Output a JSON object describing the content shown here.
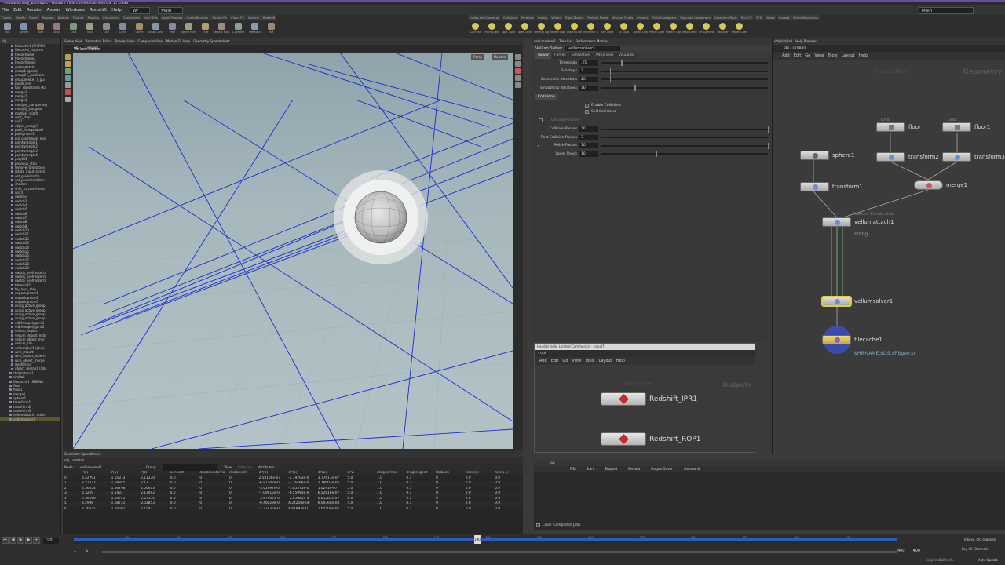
{
  "app": {
    "title": "F:/Houdini/fluffy_ball.hipnc - Houdini Indie Limited-Commercial 17.5.xxx"
  },
  "menu": {
    "items": [
      "File",
      "Edit",
      "Render",
      "Assets",
      "Windows",
      "Redshift",
      "Help"
    ],
    "desk1": "Wr",
    "desk2": "Main",
    "desk_right": "Main"
  },
  "shelf": {
    "tabs_left": [
      "Create",
      "Modify",
      "Model",
      "Polygon",
      "Deform",
      "Texture",
      "Rigging",
      "Characters",
      "Constraints",
      "Hair Utils",
      "Guide Process",
      "Guide Brushes",
      "Terrain FX",
      "Cloud FX",
      "Volume",
      "Redshift"
    ],
    "tools_left": [
      "Box",
      "Sphere",
      "Tube",
      "Torus",
      "Grid",
      "Null",
      "Line",
      "Circle",
      "Curve",
      "Draw Curve",
      "Path",
      "Spray Paint",
      "Font",
      "Platonic Solids",
      "L-System",
      "Metaball",
      "File"
    ],
    "tabs_right": [
      "Lights and Cameras",
      "Collisions",
      "Particles",
      "Grains",
      "Vellum",
      "Rigid Bodies",
      "Particle Fluids",
      "Viscous Fluids",
      "Oceans",
      "Fluid Containers",
      "Populate Containers",
      "Container Tools",
      "Pyro FX",
      "FEM",
      "Wires",
      "Crowds",
      "Drive Simulation"
    ],
    "tools_right": [
      "Camera",
      "Point Light",
      "Spot Light",
      "Area Light",
      "Geometry Light",
      "Volume Light",
      "Distant Light",
      "Environment Light",
      "Sky Light",
      "GI Light",
      "Caustic Light",
      "Portal Light",
      "Ambient Light",
      "Stereo Camera",
      "VR Camera",
      "Switcher",
      "Gamepad Camera"
    ]
  },
  "outliner": {
    "tab": "obj",
    "items": [
      "filecache1 (SHIPNA",
      "filecache_no_error",
      "freezeframe",
      "freezeframe1",
      "freezeframe2",
      "groomdetch1",
      "group1 (guide)",
      "group2 (_guidesim",
      "groupdelete1 (_gui",
      "guide_sim",
      "hair_constraints (ha",
      "merge1",
      "merge2",
      "merge3",
      "multiply_dampening",
      "multiply_kangular",
      "multiply_width",
      "next_step",
      "null1",
      "object_merge3",
      "pack_interpolated",
      "packgroom1",
      "pin_constraints (pin",
      "pointwrangle1",
      "pointwrangle2",
      "pointwrangle3",
      "pointwrangle4",
      "poly001",
      "previous_step",
      "remove_simulation",
      "rotate_input_orient",
      "set_guidsimatio",
      "set_postsimulation",
      "shaders",
      "shift_to_startframe",
      "sort1",
      "switch1",
      "switch2",
      "switch4",
      "switch5",
      "switch6",
      "switch7",
      "switch8",
      "switch9",
      "switch10",
      "switch11",
      "switch12",
      "switch13",
      "switch14",
      "switch15",
      "switch16",
      "switch17",
      "switch18",
      "switch19",
      "switch_usefreezefra",
      "switch_usefreezefra",
      "switch_usefreezefra",
      "timeshift1",
      "try_next_step",
      "unpackgroom1",
      "unpackgroom2",
      "unpackgroom3",
      "using_active_group",
      "using_active_group",
      "using_active_group",
      "using_active_group",
      "vdbfrompolygons1",
      "vdbfrompolygons2",
      "vellum_import",
      "vellum_import_exte",
      "vellum_object_mer",
      "vellum_sim",
      "vellumglue1 (glue)",
      "wire_import",
      "wire_import_extern",
      "wire_object_merge",
      "renderHair",
      "object_merge1 (/obj",
      "rbdgltstone1",
      "simBall",
      "filecache1 (SHIPNA",
      "floor",
      "floor1",
      "merge1",
      "sphere1",
      "transform1",
      "transform2",
      "transform3",
      "vellumattach1 (strin",
      "vellumsolver1"
    ],
    "selected": "vellumsolver1"
  },
  "viewport": {
    "tabs": [
      "Scene View",
      "Animation Editor",
      "Render View",
      "Composite View",
      "Motion FX View",
      "Geometry Spreadsheet"
    ],
    "path": [
      "obj",
      "simBall"
    ],
    "title": "Vellum Solver",
    "persp": "Persp",
    "cam": "No cam"
  },
  "spreadsheet": {
    "tab": "Geometry Spreadsheet",
    "path": [
      "obj",
      "simBall"
    ],
    "node_label": "Node:",
    "node": "vellumsolver1",
    "group_label": "Group:",
    "view": "View",
    "intrinsics": "Intrinsics",
    "attributes": "Attributes:",
    "columns": [
      "",
      "P[x]",
      "P[y]",
      "P[z]",
      "airresist",
      "disableexternal",
      "disableself",
      "dP[0]",
      "dP[1]",
      "dP[2]",
      "dPw",
      "dragnormal",
      "dragtangent",
      "fallback",
      "force[0]",
      "force[1]"
    ],
    "rows": [
      [
        "0",
        "3.42791",
        "1.65373",
        "2.11370",
        "0.0",
        "0",
        "0",
        "2.58106e-07",
        "-2.79293e-0",
        "3.77613e-07",
        "5.0",
        "1.0",
        "0.1",
        "0",
        "0.0",
        "0.0"
      ],
      [
        "1",
        "3.37722",
        "1.59345",
        "2.12",
        "0.0",
        "0",
        "0",
        "-6.81102e-0",
        "-3.16486e-0",
        "2.78603e-07",
        "5.0",
        "1.0",
        "0.1",
        "0",
        "0.0",
        "0.0"
      ],
      [
        "2",
        "3.36654",
        "1.66798",
        "2.06613",
        "0.0",
        "0",
        "0",
        "-3.62897e-0",
        "-5.85371e-0",
        "1.0291e-07",
        "5.0",
        "1.0",
        "0.1",
        "0",
        "0.0",
        "0.0"
      ],
      [
        "3",
        "3.3209",
        "1.5481",
        "2.13492",
        "0.0",
        "0",
        "0",
        "-7.09015e-0",
        "-6.55994e-0",
        "6.52618e-07",
        "5.0",
        "1.0",
        "0.1",
        "0",
        "0.0",
        "0.0"
      ],
      [
        "4",
        "3.30668",
        "1.60742",
        "2.07376",
        "0.0",
        "0",
        "0",
        "-3.67507e-0",
        "-2.03853e-0",
        "5.63284e-07",
        "5.0",
        "1.0",
        "0.1",
        "0",
        "0.0",
        "0.0"
      ],
      [
        "5",
        "3.2998",
        "1.68731",
        "2.02853",
        "0.0",
        "0",
        "0",
        "-6.46029e-0",
        "4.24258e-08",
        "6.09368e-08",
        "5.0",
        "1.0",
        "0.1",
        "0",
        "0.0",
        "0.0"
      ],
      [
        "6",
        "3.26835",
        "1.60501",
        "2.1542",
        "0.0",
        "0",
        "0",
        "-7.77435e-0",
        "4.41993e-07",
        "1.65509e-06",
        "5.0",
        "1.0",
        "0.1",
        "0",
        "0.0",
        "0.0"
      ]
    ]
  },
  "params": {
    "tabs": [
      "vellumsolver1",
      "Take List",
      "Performance Monitor"
    ],
    "node_type": "Vellum Solver",
    "node_name": "vellumsolver1",
    "subtabs": [
      "Solver",
      "Forces",
      "Simulation",
      "Advanced",
      "Visualize"
    ],
    "rows1": [
      {
        "label": "Timescale",
        "value": ".25",
        "knob": 0.12
      },
      {
        "label": "Substeps",
        "value": "2",
        "knob": 0.05
      },
      {
        "label": "Constraint Iterations",
        "value": "20",
        "knob": 0.05
      },
      {
        "label": "Smoothing Iterations",
        "value": "10",
        "knob": 0.2
      }
    ],
    "collisions_label": "Collisions",
    "enable_collisions": "Enable Collisions",
    "self_collisions": "Self Collisions",
    "ground_position": "Ground Position",
    "rows2": [
      {
        "label": "Collision Passes",
        "value": "10",
        "knob": 1.0
      },
      {
        "label": "Post Collision Passes",
        "value": "3",
        "knob": 0.3
      },
      {
        "label": "Polish Passes",
        "value": "10",
        "knob": 1.0
      },
      {
        "label": "Layer Shock",
        "value": "10",
        "knob": 0.33
      }
    ]
  },
  "network": {
    "tabs": [
      "/obj/simBall",
      "Help Browser"
    ],
    "path": [
      "obj",
      "simBall"
    ],
    "menu": [
      "Add",
      "Edit",
      "Go",
      "View",
      "Tools",
      "Layout",
      "Help"
    ],
    "watermark": "Indie Edition",
    "context": "Geometry",
    "grid_label": "Grid",
    "floor": "floor",
    "floor1": "floor1",
    "sphere1": "sphere1",
    "transform1": "transform1",
    "transform2": "transform2",
    "transform3": "transform3",
    "merge1": "merge1",
    "vc_label": "Vellum Constraints",
    "vellumattach1": "vellumattach1",
    "vellumattach_sub": "string",
    "vellumsolver1": "vellumsolver1",
    "filecache1": "filecache1",
    "filecache_sub": "$HIPNAME.$OS.$F.bgeo.sc"
  },
  "render": {
    "title": "Houdini Indie Limited-Commercial - panel7",
    "path": "out",
    "menu": [
      "Add",
      "Edit",
      "Go",
      "View",
      "Tools",
      "Layout",
      "Help"
    ],
    "watermark": "Indie Edition",
    "context": "Outputs",
    "rop1": "Redshift_IPR1",
    "rop2": "Redshift_ROP1"
  },
  "outpanel": {
    "tab": "out",
    "cols": [
      "PID",
      "Start",
      "Elapsed",
      "Percent",
      "Output Driver",
      "Command"
    ],
    "clear": "Clear Completed Jobs"
  },
  "timeline": {
    "frame": "190",
    "start": "1",
    "start2": "1",
    "end": "400",
    "end2": "400",
    "ticks": [
      "1",
      "25",
      "50",
      "75",
      "100",
      "125",
      "150",
      "175",
      "200",
      "225",
      "250",
      "275",
      "300",
      "325",
      "350",
      "375"
    ],
    "keys": "0 keys, 0/0 channels",
    "key_all": "Key All Channels",
    "auto_update": "Auto Update",
    "status": "/obj/simBall/vell..."
  }
}
